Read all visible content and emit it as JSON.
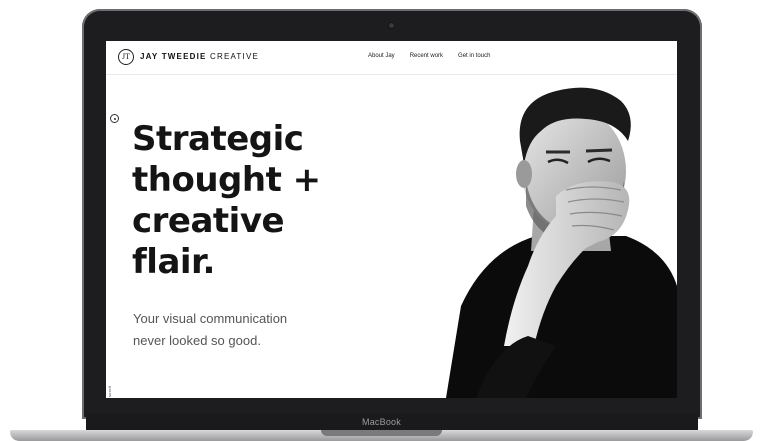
{
  "device": {
    "brand_label": "MacBook"
  },
  "site": {
    "logo": {
      "mark": "JT",
      "name_bold": "JAY TWEEDIE",
      "name_regular": "CREATIVE"
    },
    "nav": [
      {
        "label": "About Jay"
      },
      {
        "label": "Recent work"
      },
      {
        "label": "Get in touch"
      }
    ],
    "hero": {
      "title_lines": [
        "Strategic",
        "thought +",
        "creative",
        "flair."
      ],
      "subtitle_lines": [
        "Your visual communication",
        "never looked so good."
      ]
    },
    "side_vertical_text": "scroll"
  },
  "colors": {
    "text_dark": "#141414",
    "text_muted": "#555555",
    "bezel": "#1d1d1f"
  }
}
